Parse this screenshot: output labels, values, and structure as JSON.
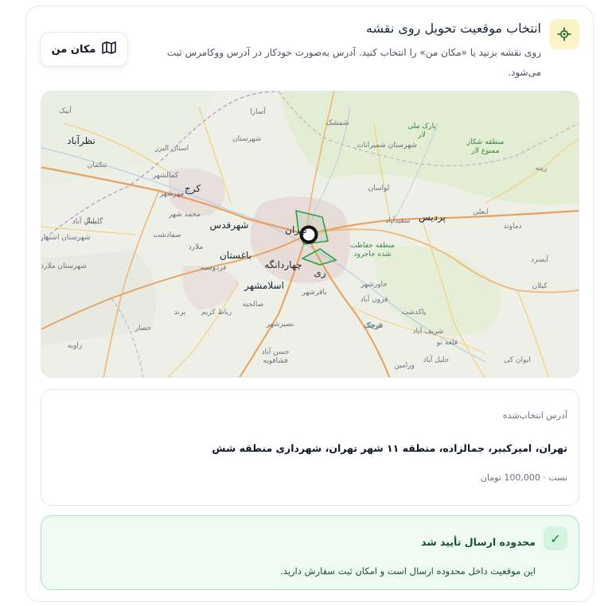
{
  "header": {
    "title": "انتخاب موقعیت تحویل روی نقشه",
    "description": "روی نقشه بزنید یا «مکان من» را انتخاب کنید. آدرس به‌صورت خودکار در آدرس ووکامرس ثبت می‌شود.",
    "my_location_label": "مکان من",
    "pin_icon": "crosshair-pin-icon",
    "map_icon": "map-icon"
  },
  "map": {
    "labels": [
      {
        "text": "تهران",
        "kind": "big"
      },
      {
        "text": "کرج",
        "kind": "big"
      },
      {
        "text": "شهرقدس",
        "kind": "big"
      },
      {
        "text": "پردیس",
        "kind": "big"
      },
      {
        "text": "باغستان",
        "kind": "big"
      },
      {
        "text": "چهاردانگه",
        "kind": "big"
      },
      {
        "text": "اسلامشهر",
        "kind": "big"
      },
      {
        "text": "ری",
        "kind": "big"
      },
      {
        "text": "نظرآباد",
        "kind": "big"
      },
      {
        "text": "آبیک",
        "kind": "sm"
      },
      {
        "text": "آسارا",
        "kind": "sm"
      },
      {
        "text": "شمشک",
        "kind": "sm"
      },
      {
        "text": "پارک ملی لار",
        "kind": "green"
      },
      {
        "text": "منطقه شکار ممنوع لار",
        "kind": "green"
      },
      {
        "text": "استان البرز",
        "kind": "sm"
      },
      {
        "text": "تنکمان",
        "kind": "sm"
      },
      {
        "text": "کمالشهر",
        "kind": "sm"
      },
      {
        "text": "مهرشهر",
        "kind": "sm"
      },
      {
        "text": "محمد شهر",
        "kind": "sm"
      },
      {
        "text": "گلسار",
        "kind": "sm"
      },
      {
        "text": "صفادشت",
        "kind": "sm"
      },
      {
        "text": "ملارد",
        "kind": "sm"
      },
      {
        "text": "فردوسیه",
        "kind": "sm"
      },
      {
        "text": "صالحیه",
        "kind": "sm"
      },
      {
        "text": "پرند",
        "kind": "sm"
      },
      {
        "text": "رباط کریم",
        "kind": "sm"
      },
      {
        "text": "نصیرشهر",
        "kind": "sm"
      },
      {
        "text": "حسن آباد فشافویه",
        "kind": "sm"
      },
      {
        "text": "زاویه",
        "kind": "sm"
      },
      {
        "text": "رینه",
        "kind": "sm"
      },
      {
        "text": "ابعلی",
        "kind": "sm"
      },
      {
        "text": "دماوند",
        "kind": "sm"
      },
      {
        "text": "آبسرد",
        "kind": "sm"
      },
      {
        "text": "کیلان",
        "kind": "sm"
      },
      {
        "text": "لواسان",
        "kind": "sm"
      },
      {
        "text": "سعیدآباد",
        "kind": "sm"
      },
      {
        "text": "منطقه حفاظت شده جاجرود",
        "kind": "green"
      },
      {
        "text": "خاورشهر",
        "kind": "sm"
      },
      {
        "text": "قرچک",
        "kind": "sm"
      },
      {
        "text": "پاکدشت",
        "kind": "sm"
      },
      {
        "text": "شریف آباد",
        "kind": "sm"
      },
      {
        "text": "ورامین",
        "kind": "sm"
      },
      {
        "text": "جلیل آباد",
        "kind": "sm"
      },
      {
        "text": "ایوان کی",
        "kind": "sm"
      },
      {
        "text": "باقرشهر",
        "kind": "sm"
      },
      {
        "text": "قلعه نو",
        "kind": "sm"
      },
      {
        "text": "قرچک",
        "kind": "sm"
      },
      {
        "text": "شهرستان شمیرانات",
        "kind": "sm"
      },
      {
        "text": "شهرستان ملارد",
        "kind": "sm"
      },
      {
        "text": "شهرستان اشتهارد",
        "kind": "sm"
      },
      {
        "text": "پلنگ آباد",
        "kind": "sm"
      },
      {
        "text": "فرون آباد",
        "kind": "sm"
      },
      {
        "text": "حصار",
        "kind": "sm"
      },
      {
        "text": "شهرستان",
        "kind": "sm"
      }
    ]
  },
  "address": {
    "label": "آدرس انتخاب‌شده",
    "value": "تهران، امیرکبیر، جمالزاده، منطقه ۱۱ شهر تهران، شهرداری منطقه شش",
    "sub": "تست · 100,000 تومان"
  },
  "status": {
    "title": "محدوده ارسال تأیید شد",
    "message": "این موقعیت داخل محدوده ارسال است و امکان ثبت سفارش دارید.",
    "icon": "check-icon",
    "color": "#15803d"
  }
}
